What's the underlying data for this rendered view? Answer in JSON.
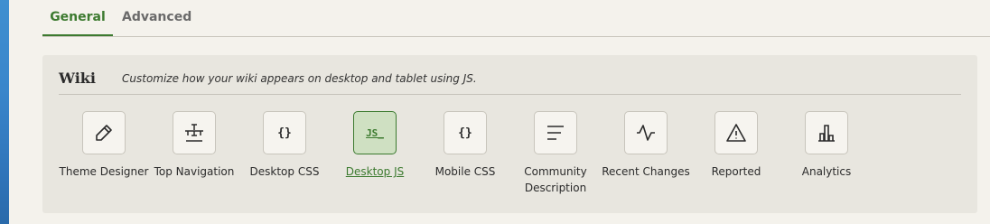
{
  "tabs": {
    "general": "General",
    "advanced": "Advanced"
  },
  "panel": {
    "title": "Wiki",
    "description": "Customize how your wiki appears on desktop and tablet using JS."
  },
  "tools": [
    {
      "label": "Theme Designer",
      "icon": "pencil-icon"
    },
    {
      "label": "Top Navigation",
      "icon": "sitemap-icon"
    },
    {
      "label": "Desktop CSS",
      "icon": "braces-icon",
      "glyph": "{}"
    },
    {
      "label": "Desktop JS",
      "icon": "js-icon",
      "glyph": "JS_",
      "active": true
    },
    {
      "label": "Mobile CSS",
      "icon": "braces-icon",
      "glyph": "{}"
    },
    {
      "label": "Community Description",
      "icon": "text-lines-icon"
    },
    {
      "label": "Recent Changes",
      "icon": "activity-icon"
    },
    {
      "label": "Reported",
      "icon": "warning-icon"
    },
    {
      "label": "Analytics",
      "icon": "bar-chart-icon"
    }
  ],
  "colors": {
    "accent": "#3c7a2f",
    "page_bg": "#f4f2ec",
    "panel_bg": "#e8e6df"
  }
}
